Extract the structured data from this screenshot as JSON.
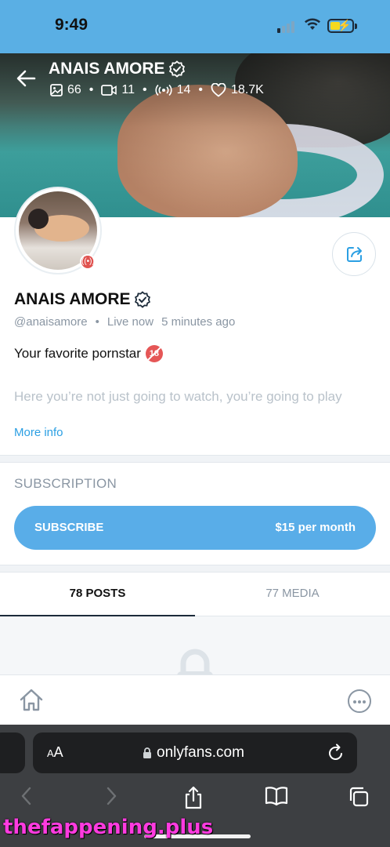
{
  "status_bar": {
    "time": "9:49"
  },
  "profile": {
    "name": "ANAIS AMORE",
    "verified": true,
    "stats": {
      "photos": "66",
      "videos": "11",
      "streams": "14",
      "likes": "18.7K"
    },
    "handle": "@anaisamore",
    "live_status": "Live now",
    "last_seen": "5 minutes ago",
    "bio_line": "Your favorite pornstar",
    "age_badge": "18",
    "bio_line2": "Here you’re not just going to watch, you’re going to play",
    "more_info": "More info"
  },
  "subscription": {
    "section_label": "SUBSCRIPTION",
    "button_label": "SUBSCRIBE",
    "price": "$15 per month"
  },
  "tabs": [
    {
      "label": "78 POSTS",
      "active": true
    },
    {
      "label": "77 MEDIA",
      "active": false
    }
  ],
  "browser": {
    "aa_label": "AA",
    "url": "onlyfans.com"
  },
  "watermark": "thefappening.plus",
  "colors": {
    "status_bar_bg": "#5aafe4",
    "accent": "#59ade8",
    "link": "#2b9fe3",
    "muted": "#8a96a3",
    "live_badge": "#e0524f"
  },
  "icons": [
    "back-arrow-icon",
    "verified-icon",
    "image-icon",
    "video-icon",
    "stream-icon",
    "heart-icon",
    "share-icon",
    "lock-icon",
    "home-icon",
    "more-icon",
    "padlock-icon",
    "reload-icon",
    "chevron-left-icon",
    "chevron-right-icon",
    "share-sheet-icon",
    "bookmarks-icon",
    "tabs-icon"
  ]
}
